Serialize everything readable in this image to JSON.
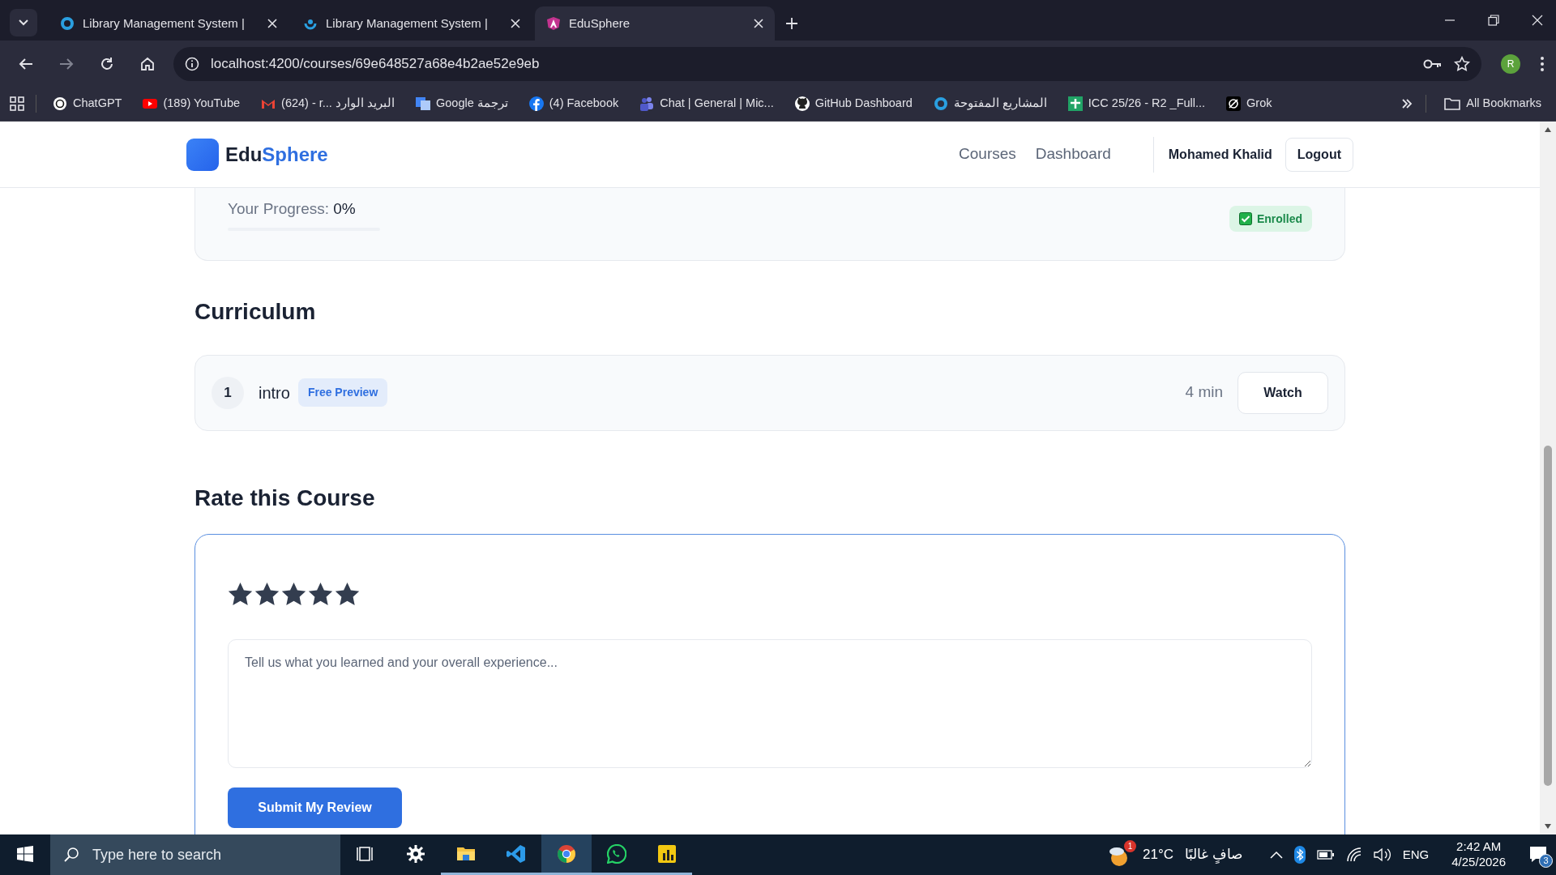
{
  "browser": {
    "tabs": [
      {
        "title": "Library Management System |",
        "kind": "ring",
        "selected": false
      },
      {
        "title": "Library Management System |",
        "kind": "swirl",
        "selected": false
      },
      {
        "title": "EduSphere",
        "kind": "angular",
        "selected": true
      }
    ],
    "url": "localhost:4200/courses/69e648527a68e4b2ae52e9eb",
    "profile": "R",
    "bookmarks": [
      {
        "label": "ChatGPT",
        "kind": "knot"
      },
      {
        "label": "(189) YouTube",
        "kind": "play"
      },
      {
        "label": "(624) - r... البريد الوارد",
        "kind": "mail"
      },
      {
        "label": "Google ترجمة",
        "kind": "translate"
      },
      {
        "label": "(4) Facebook",
        "kind": "facebook"
      },
      {
        "label": "Chat | General | Mic...",
        "kind": "teams"
      },
      {
        "label": "GitHub Dashboard",
        "kind": "github"
      },
      {
        "label": "المشاريع المفتوحة",
        "kind": "ring"
      },
      {
        "label": "ICC 25/26 - R2 _Full...",
        "kind": "sheet"
      },
      {
        "label": "Grok",
        "kind": "grok"
      }
    ],
    "all_bookmarks": "All Bookmarks"
  },
  "header": {
    "logo": [
      "Edu",
      "Sphere"
    ],
    "nav": [
      {
        "label": "Courses"
      },
      {
        "label": "Dashboard"
      }
    ],
    "user": "Mohamed Khalid",
    "logout": "Logout"
  },
  "progress": {
    "label": "Your Progress:",
    "value": "0%",
    "level": 0,
    "badge": "Enrolled"
  },
  "curriculum": {
    "title": "Curriculum",
    "lessons": [
      {
        "number": "1",
        "title": "intro",
        "badge": "Free Preview",
        "duration": "4 min",
        "action": "Watch"
      }
    ]
  },
  "review": {
    "title": "Rate this Course",
    "stars": 5,
    "placeholder": "Tell us what you learned and your overall experience...",
    "submit": "Submit My Review"
  },
  "taskbar": {
    "search_placeholder": "Type here to search",
    "apps": [
      {
        "kind": "taskview",
        "running": false,
        "selected": false
      },
      {
        "kind": "settings",
        "running": false,
        "selected": false
      },
      {
        "kind": "folder",
        "running": true,
        "selected": false
      },
      {
        "kind": "vscode",
        "running": true,
        "selected": false
      },
      {
        "kind": "chrome",
        "running": true,
        "selected": true
      },
      {
        "kind": "whatsapp",
        "running": true,
        "selected": false
      },
      {
        "kind": "chart",
        "running": true,
        "selected": false
      }
    ],
    "weather_badge": "1",
    "temperature": "21°C",
    "weather": "صافٍ غالبًا",
    "language": "ENG",
    "time": "2:42 AM",
    "date": "4/25/2026",
    "notifications": "3"
  }
}
